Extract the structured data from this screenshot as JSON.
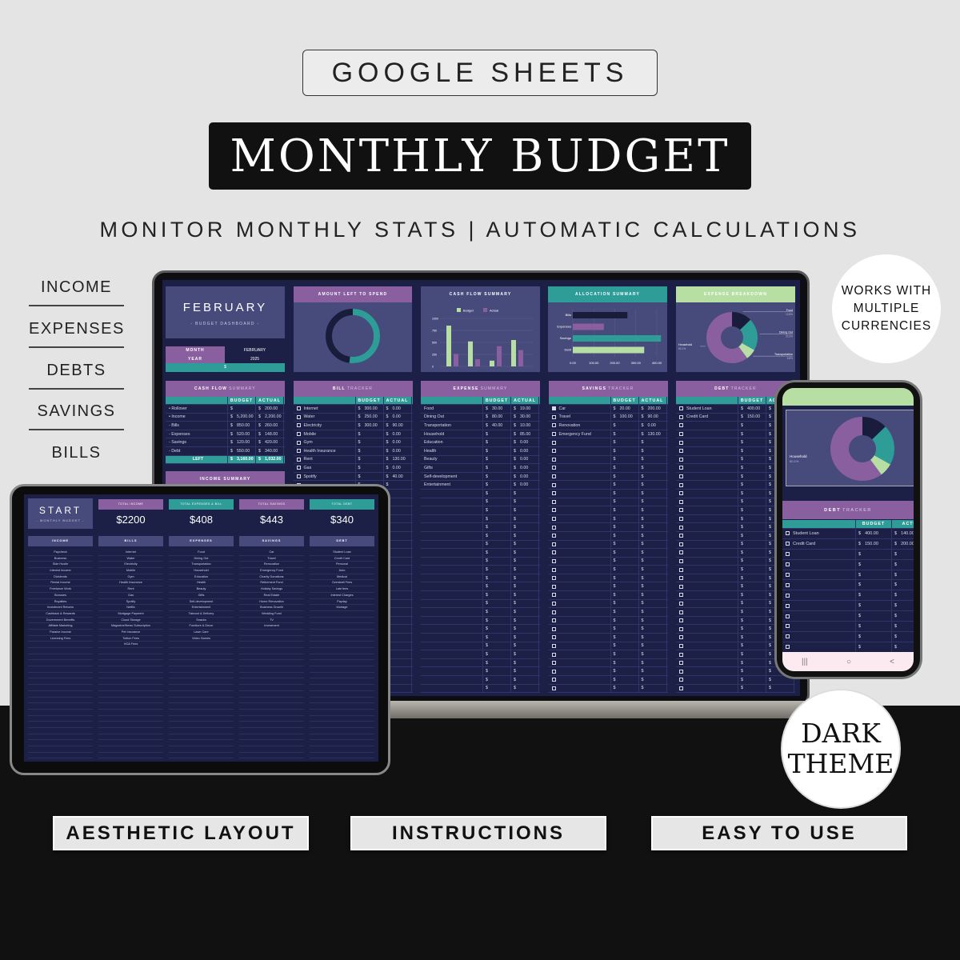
{
  "header": {
    "platform": "GOOGLE SHEETS",
    "title": "MONTHLY BUDGET",
    "subtitle": "MONITOR MONTHLY STATS | AUTOMATIC CALCULATIONS"
  },
  "features": [
    "INCOME",
    "EXPENSES",
    "DEBTS",
    "SAVINGS",
    "BILLS"
  ],
  "badges": {
    "currency": "WORKS WITH MULTIPLE CURRENCIES",
    "theme": "DARK THEME"
  },
  "buttons": [
    "AESTHETIC LAYOUT",
    "INSTRUCTIONS",
    "EASY TO USE"
  ],
  "colors": {
    "navy": "#1c2046",
    "panel": "#474b7c",
    "purple": "#8a5fa0",
    "teal": "#2e9d98",
    "green": "#b7dfa3",
    "dark": "#1a1c3c"
  },
  "dashboard": {
    "month_title": "FEBRUARY",
    "dashboard_label": "- BUDGET DASHBOARD -",
    "month_label": "MONTH",
    "month_value": "FEBRUARY",
    "year_label": "YEAR",
    "year_value": "2025",
    "currency_value": "$",
    "amount_left_title": "AMOUNT LEFT TO SPEND",
    "amount_left_fraction": 0.52,
    "cash_flow_chart": {
      "title": "CASH FLOW SUMMARY",
      "legend": [
        "Budget",
        "Actual"
      ],
      "ticks": [
        "1000",
        "750",
        "500",
        "250",
        "0"
      ],
      "budget": [
        850,
        520,
        120,
        550
      ],
      "actual": [
        260,
        148,
        420,
        340
      ]
    },
    "allocation_chart": {
      "title": "ALLOCATION SUMMARY",
      "categories": [
        "Bills",
        "Expenses",
        "Savings",
        "Debt"
      ],
      "values": [
        260,
        148,
        420,
        340
      ],
      "ticks": [
        "0.00",
        "100.00",
        "200.00",
        "300.00",
        "400.00"
      ]
    },
    "expense_breakdown": {
      "title": "EXPENSE BREAKDOWN",
      "slices": [
        {
          "label": "Food",
          "pct": "12.8%",
          "value": 12.8
        },
        {
          "label": "Dining Out",
          "pct": "20.3%",
          "value": 20.3
        },
        {
          "label": "Transportation",
          "pct": "6.8%",
          "value": 6.8
        },
        {
          "label": "Household",
          "pct": "60.1%",
          "value": 60.1
        }
      ]
    },
    "budget_label": "BUDGET",
    "actual_label": "ACTUAL",
    "trackers": [
      {
        "title": "CASH FLOW",
        "title2": "SUMMARY",
        "type": "bullet",
        "rows": [
          [
            "• Rollover",
            "",
            "200.00"
          ],
          [
            "• Income",
            "5,200.00",
            "2,200.00"
          ],
          [
            "- Bills",
            "850.00",
            "260.00"
          ],
          [
            "- Expenses",
            "520.00",
            "148.00"
          ],
          [
            "- Savings",
            "120.00",
            "420.00"
          ],
          [
            "- Debt",
            "550.00",
            "340.00"
          ]
        ],
        "left": [
          "LEFT",
          "3,160.00",
          "1,032.00"
        ],
        "footer": "INCOME SUMMARY"
      },
      {
        "title": "BILL",
        "title2": "TRACKER",
        "type": "check",
        "rows": [
          [
            "Internet",
            "300.00",
            "0.00"
          ],
          [
            "Water",
            "250.00",
            "0.00"
          ],
          [
            "Electricity",
            "300.00",
            "90.00"
          ],
          [
            "Mobile",
            "",
            "0.00"
          ],
          [
            "Gym",
            "",
            "0.00"
          ],
          [
            "Health Insurance",
            "",
            "0.00"
          ],
          [
            "Rent",
            "",
            "130.00"
          ],
          [
            "Gas",
            "",
            "0.00"
          ],
          [
            "Spotify",
            "",
            "40.00"
          ]
        ]
      },
      {
        "title": "EXPENSE",
        "title2": "SUMMARY",
        "type": "plain",
        "rows": [
          [
            "Food",
            "30.00",
            "19.00"
          ],
          [
            "Dining Out",
            "80.00",
            "30.00"
          ],
          [
            "Transportation",
            "40.00",
            "10.00"
          ],
          [
            "Household",
            "",
            "85.00"
          ],
          [
            "Education",
            "",
            "0.00"
          ],
          [
            "Health",
            "",
            "0.00"
          ],
          [
            "Beauty",
            "",
            "0.00"
          ],
          [
            "Gifts",
            "",
            "0.00"
          ],
          [
            "Self-development",
            "",
            "0.00"
          ],
          [
            "Entertainment",
            "",
            "0.00"
          ]
        ]
      },
      {
        "title": "SAVINGS",
        "title2": "TRACKER",
        "type": "check",
        "checked": [
          0
        ],
        "rows": [
          [
            "Car",
            "20.00",
            "200.00"
          ],
          [
            "Travel",
            "100.00",
            "90.00"
          ],
          [
            "Renovation",
            "",
            "0.00"
          ],
          [
            "Emergency Fund",
            "",
            "130.00"
          ]
        ]
      },
      {
        "title": "DEBT",
        "title2": "TRACKER",
        "type": "check",
        "rows": [
          [
            "Student Loan",
            "400.00",
            ""
          ],
          [
            "Credit Card",
            "150.00",
            ""
          ]
        ]
      }
    ]
  },
  "start_sheet": {
    "title": "START",
    "subtitle": "- MONTHLY BUDGET -",
    "totals": [
      {
        "label": "TOTAL INCOME",
        "value": "$2200"
      },
      {
        "label": "TOTAL EXPENSES & BILL",
        "value": "$408"
      },
      {
        "label": "TOTAL SAVINGS",
        "value": "$443"
      },
      {
        "label": "TOTAL DEBT",
        "value": "$340"
      }
    ],
    "categories": [
      {
        "name": "INCOME",
        "items": [
          "Paycheck",
          "Business",
          "Side Hustle",
          "Interest Income",
          "Dividends",
          "Rental Income",
          "Freelance Work",
          "Bonuses",
          "Royalties",
          "Investment Returns",
          "Cashback & Rewards",
          "Government Benefits",
          "Affiliate Marketing",
          "Passive Income",
          "Licensing Fees"
        ]
      },
      {
        "name": "BILLS",
        "items": [
          "Internet",
          "Water",
          "Electricity",
          "Mobile",
          "Gym",
          "Health Insurance",
          "Rent",
          "Gas",
          "Spotify",
          "Netflix",
          "Mortgage Payment",
          "Cloud Storage",
          "Magazine/News Subscription",
          "Pet Insurance",
          "Tuition Fees",
          "HOA Fees"
        ]
      },
      {
        "name": "EXPENSES",
        "items": [
          "Food",
          "Dining Out",
          "Transportation",
          "Household",
          "Education",
          "Health",
          "Beauty",
          "Gifts",
          "Self-development",
          "Entertainment",
          "Takeout & Delivery",
          "Snacks",
          "Furniture & Decor",
          "Lawn Care",
          "Video Games"
        ]
      },
      {
        "name": "SAVINGS",
        "items": [
          "Car",
          "Travel",
          "Renovation",
          "Emergency Fund",
          "Charity Donations",
          "Retirement Fund",
          "Holiday Savings",
          "Real Estate",
          "Home Renovation",
          "Business Growth",
          "Wedding Fund",
          "TV",
          "Investment"
        ]
      },
      {
        "name": "DEBT",
        "items": [
          "Student Loan",
          "Credit Card",
          "Personal",
          "Auto",
          "Medical",
          "Overdraft Fees",
          "Late fees",
          "Interest Charges",
          "Payday",
          "Mortage"
        ]
      }
    ]
  },
  "phone": {
    "tracker_title": "DEBT",
    "tracker_title2": "TRACKER",
    "budget_label": "BUDGET",
    "actual_label": "ACTU",
    "chart_label": "Household",
    "chart_pct": "60.1%",
    "rows": [
      [
        "Student Loan",
        "400.00",
        "140.00"
      ],
      [
        "Credit Card",
        "150.00",
        "200.00"
      ]
    ],
    "nav": [
      "|||",
      "○",
      "<"
    ]
  }
}
